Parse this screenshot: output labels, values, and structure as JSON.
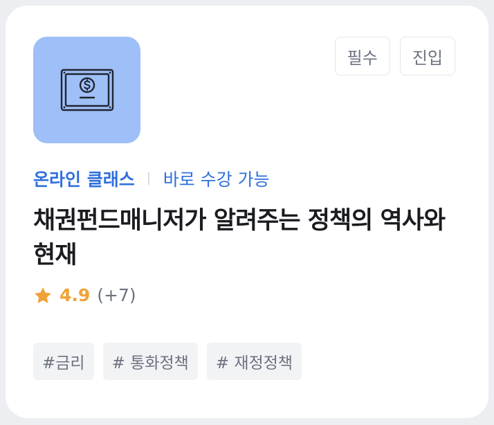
{
  "course": {
    "thumbnail_icon": "money-bill-icon",
    "thumbnail_color": "#9ebff7",
    "badges": [
      {
        "label": "필수"
      },
      {
        "label": "진입"
      }
    ],
    "class_type": "온라인 클래스",
    "availability": "바로 수강 가능",
    "title": "채권펀드매니저가 알려주는 정책의 역사와 현재",
    "rating": {
      "score": "4.9",
      "count": "(+7)",
      "star_color": "#f0a236"
    },
    "tags": [
      {
        "label": "#금리"
      },
      {
        "label": "# 통화정책"
      },
      {
        "label": "# 재정정책"
      }
    ],
    "accent_color": "#2f6fdc"
  }
}
